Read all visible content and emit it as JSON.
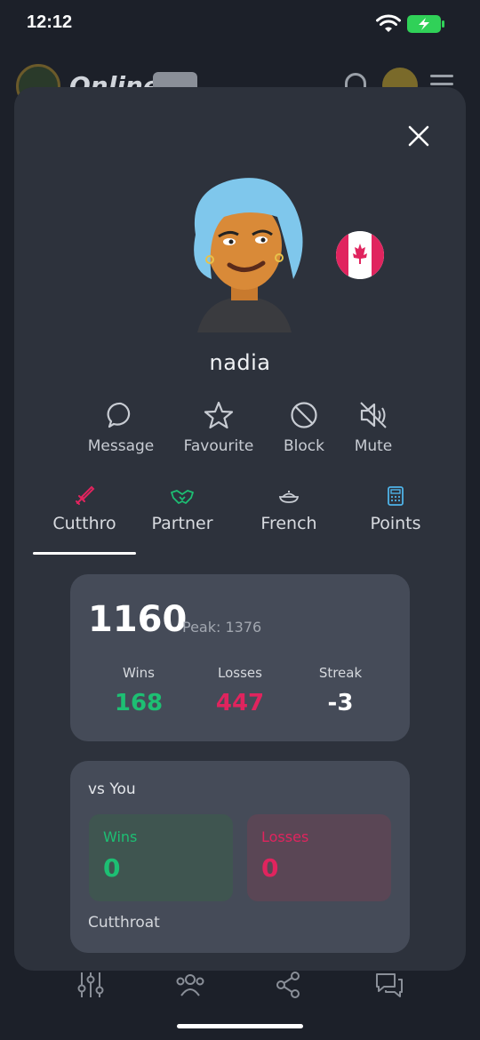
{
  "status_bar": {
    "time": "12:12"
  },
  "background_app": {
    "title": "Online"
  },
  "profile": {
    "username": "nadia",
    "country": "Canada"
  },
  "actions": [
    {
      "label": "Message",
      "icon": "chat-bubble-icon"
    },
    {
      "label": "Favourite",
      "icon": "star-icon"
    },
    {
      "label": "Block",
      "icon": "block-icon"
    },
    {
      "label": "Mute",
      "icon": "mute-icon"
    }
  ],
  "tabs": [
    {
      "label": "Cutthro",
      "icon": "sword-icon",
      "icon_color": "#e0245e",
      "active": true
    },
    {
      "label": "Partner",
      "icon": "handshake-icon",
      "icon_color": "#1dbf73",
      "active": false
    },
    {
      "label": "French",
      "icon": "pot-icon",
      "icon_color": "#c8ccd3",
      "active": false
    },
    {
      "label": "Points",
      "icon": "calculator-icon",
      "icon_color": "#4fb3e8",
      "active": false
    }
  ],
  "stats": {
    "rating": "1160",
    "peak": "Peak: 1376",
    "wins_label": "Wins",
    "wins": "168",
    "losses_label": "Losses",
    "losses": "447",
    "streak_label": "Streak",
    "streak": "-3"
  },
  "vs_you": {
    "title": "vs You",
    "wins_label": "Wins",
    "wins": "0",
    "losses_label": "Losses",
    "losses": "0",
    "mode": "Cutthroat"
  },
  "colors": {
    "win": "#1dbf73",
    "loss": "#e0245e",
    "modal_bg": "#2d323c",
    "card_bg": "#454b58"
  }
}
